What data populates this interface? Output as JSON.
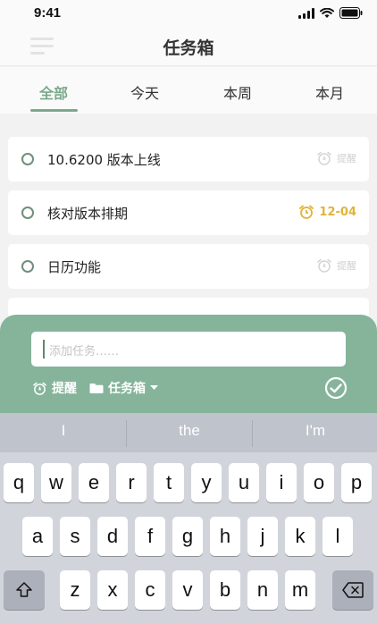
{
  "status_bar": {
    "time": "9:41"
  },
  "nav": {
    "title": "任务箱"
  },
  "tabs": [
    {
      "label": "全部"
    },
    {
      "label": "今天"
    },
    {
      "label": "本周"
    },
    {
      "label": "本月"
    }
  ],
  "tasks": [
    {
      "title": "10.6200 版本上线",
      "reminder": "提醒"
    },
    {
      "title": "核对版本排期",
      "reminder": "12-04"
    },
    {
      "title": "日历功能",
      "reminder": "提醒"
    }
  ],
  "compose": {
    "placeholder": "添加任务……",
    "reminder_label": "提醒",
    "folder_label": "任务箱"
  },
  "keyboard": {
    "suggestions": [
      "I",
      "the",
      "I'm"
    ],
    "row1": [
      "q",
      "w",
      "e",
      "r",
      "t",
      "y",
      "u",
      "i",
      "o",
      "p"
    ],
    "row2": [
      "a",
      "s",
      "d",
      "f",
      "g",
      "h",
      "j",
      "k",
      "l"
    ],
    "row3": [
      "z",
      "x",
      "c",
      "v",
      "b",
      "n",
      "m"
    ]
  },
  "colors": {
    "accent": "#7aa98b",
    "compose_bg": "#85b49a",
    "due": "#e0b43a"
  }
}
